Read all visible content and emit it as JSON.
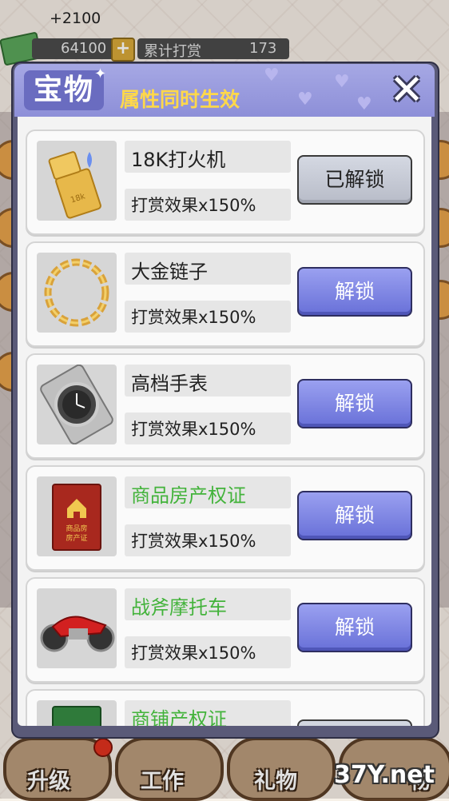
{
  "hud": {
    "score_delta": "+2100",
    "money": "64100",
    "plus": "+",
    "tip_label": "累计打赏",
    "tip_value": "173"
  },
  "modal": {
    "title": "宝物",
    "subtitle": "属性同时生效",
    "close": "✕",
    "items": [
      {
        "name": "18K打火机",
        "effect": "打赏效果x150%",
        "button": "已解锁",
        "state": "unlocked",
        "name_color": "#222222",
        "icon": "gold-lighter-icon"
      },
      {
        "name": "大金链子",
        "effect": "打赏效果x150%",
        "button": "解锁",
        "state": "locked",
        "name_color": "#222222",
        "icon": "gold-chain-icon"
      },
      {
        "name": "高档手表",
        "effect": "打赏效果x150%",
        "button": "解锁",
        "state": "locked",
        "name_color": "#222222",
        "icon": "wristwatch-icon"
      },
      {
        "name": "商品房产权证",
        "effect": "打赏效果x150%",
        "button": "解锁",
        "state": "locked",
        "name_color": "#43b33b",
        "icon": "property-certificate-icon",
        "icon_text": "商品房\n房产证"
      },
      {
        "name": "战斧摩托车",
        "effect": "打赏效果x150%",
        "button": "解锁",
        "state": "locked",
        "name_color": "#43b33b",
        "icon": "motorcycle-icon"
      },
      {
        "name": "商铺产权证",
        "effect": "",
        "button": "",
        "state": "locked",
        "name_color": "#43b33b",
        "icon": "shop-certificate-icon"
      }
    ]
  },
  "nav": {
    "upgrade": "升级",
    "work": "工作",
    "gift": "礼物",
    "fourth": "物"
  },
  "watermark": "37Y.net",
  "colors": {
    "modal_header": "#8d8fd8",
    "button_locked": "#6870d8",
    "subtitle": "#ffd84a",
    "green_name": "#43b33b"
  }
}
